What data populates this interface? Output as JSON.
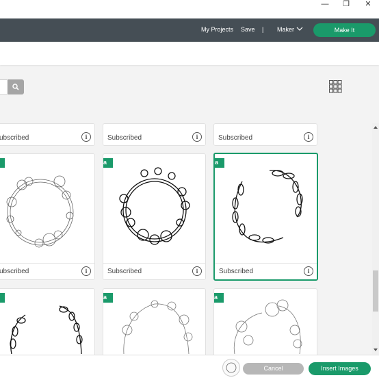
{
  "window_controls": {
    "minimize": "—",
    "restore": "❐",
    "close": "✕"
  },
  "header": {
    "my_projects": "My Projects",
    "save": "Save",
    "divider": "|",
    "machine": "Maker",
    "make_it": "Make It"
  },
  "cards": [
    {
      "label": "ubscribed",
      "info": "i"
    },
    {
      "label": "Subscribed",
      "info": "i"
    },
    {
      "label": "Subscribed",
      "info": "i"
    },
    {
      "label": "ubscribed",
      "info": "i"
    },
    {
      "label": "Subscribed",
      "info": "i"
    },
    {
      "label": "Subscribed",
      "info": "i"
    }
  ],
  "badge_glyph": "a",
  "footer": {
    "cancel": "Cancel",
    "insert": "Insert Images"
  },
  "colors": {
    "accent": "#1a9a6a",
    "header": "#454e55"
  }
}
